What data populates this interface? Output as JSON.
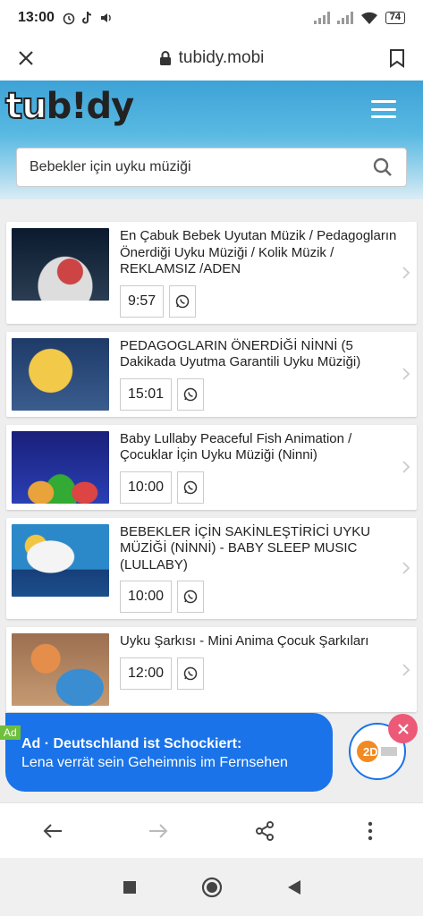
{
  "status_bar": {
    "time": "13:00",
    "battery": "74"
  },
  "browser": {
    "url": "tubidy.mobi"
  },
  "site": {
    "logo_parts": [
      "tu",
      "b!dy"
    ],
    "search": {
      "value": "Bebekler için uyku müziği"
    }
  },
  "results": [
    {
      "title": "En Çabuk Bebek Uyutan Müzik / Pedagogların Önerdiği Uyku Müziği / Kolik Müzik / REKLAMSIZ /ADEN",
      "duration": "9:57"
    },
    {
      "title": "PEDAGOGLARIN ÖNERDİĞİ NİNNİ (5 Dakikada Uyutma Garantili Uyku Müziği)",
      "duration": "15:01"
    },
    {
      "title": "Baby Lullaby Peaceful Fish Animation / Çocuklar İçin Uyku Müziği (Ninni)",
      "duration": "10:00"
    },
    {
      "title": "BEBEKLER İÇİN SAKİNLEŞTİRİCİ UYKU MÜZİĞİ (NİNNİ) - BABY SLEEP MUSIC (LULLABY)",
      "duration": "10:00"
    },
    {
      "title": "Uyku Şarkısı - Mini Anima Çocuk Şarkıları",
      "duration": "12:00"
    }
  ],
  "ad": {
    "tag": "Ad",
    "title": "Ad · Deutschland ist Schockiert:",
    "subtitle": "Lena verrät sein Geheimnis im Fernsehen",
    "logo_text": "2D"
  },
  "colors": {
    "header_blue": "#3ea2d6",
    "ad_blue": "#1a73e8",
    "ad_close": "#ec5a78",
    "ad_tag": "#6fbf3b"
  }
}
